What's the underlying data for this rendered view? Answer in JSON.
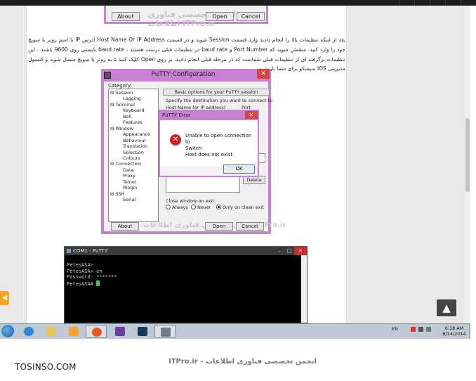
{
  "paragraph": "بعد از اینکه تنظیمات بالا را انجام دادید وارد قسمت Session شوید و در قسمت Host Name Or IP Address آدرس IP یا اسم روتر یا سویچ خود را وارد کنید. مطمئن شوید که Port Number و baud rate در تنظیمات قبلی درست هستند ، baud rate بایستی روی 9600 باشند ، این تنظیمات برگرفته ای از تنظیمات قبلی شماست که در مرحله قبلی انجام دادید. بر روی Open کلیک کنید تا به روتر یا سویچ متصل شوید و کنسول مدیریتی IOS سیسکو برای شما باز شود.",
  "top_crop": {
    "about_label": "About",
    "open_label": "Open",
    "cancel_label": "Cancel",
    "watermark": "انجمن تخصصی فناوری اطلاعات ITPro.ir"
  },
  "putty_config": {
    "title": "PuTTY Configuration",
    "category_label": "Category:",
    "tree": [
      {
        "label": "Session",
        "prefix": "⊟"
      },
      {
        "label": "Logging",
        "prefix": ""
      },
      {
        "label": "Terminal",
        "prefix": "⊟"
      },
      {
        "label": "Keyboard",
        "prefix": ""
      },
      {
        "label": "Bell",
        "prefix": ""
      },
      {
        "label": "Features",
        "prefix": ""
      },
      {
        "label": "Window",
        "prefix": "⊟"
      },
      {
        "label": "Appearance",
        "prefix": ""
      },
      {
        "label": "Behaviour",
        "prefix": ""
      },
      {
        "label": "Translation",
        "prefix": ""
      },
      {
        "label": "Selection",
        "prefix": ""
      },
      {
        "label": "Colours",
        "prefix": ""
      },
      {
        "label": "Connection",
        "prefix": "⊟"
      },
      {
        "label": "Data",
        "prefix": ""
      },
      {
        "label": "Proxy",
        "prefix": ""
      },
      {
        "label": "Telnet",
        "prefix": ""
      },
      {
        "label": "Rlogin",
        "prefix": ""
      },
      {
        "label": "SSH",
        "prefix": "⊞"
      },
      {
        "label": "Serial",
        "prefix": ""
      }
    ],
    "basic_options_label": "Basic options for your PuTTY session",
    "specify_label": "Specify the destination you want to connect to",
    "host_label": "Host Name (or IP address)",
    "port_label": "Port",
    "delete_label": "Delete",
    "close_window_label": "Close window on exit:",
    "radio_always": "Always",
    "radio_never": "Never",
    "radio_clean": "Only on clean exit",
    "about_label": "About",
    "open_label": "Open",
    "cancel_label": "Cancel",
    "watermark": "انجمن تخصصی فناوری اطلاعات ITPro.ir"
  },
  "error_dialog": {
    "title": "PuTTY Error",
    "line1": "Unable to open connection to",
    "line2": "Switch",
    "line3": "Host does not exist",
    "ok_label": "OK"
  },
  "terminal": {
    "title": "COM1 - PuTTY",
    "lines": [
      "PetesASA>",
      "PetesASA> en",
      "Password: *******",
      "PetesASA# "
    ]
  },
  "taskbar": {
    "lang": "EN",
    "time": "6:18 AM",
    "date": "8/14/2014"
  },
  "footer": {
    "logo": "TOSINSO.COM",
    "caption": "انجمن تخصصی فناوری اطلاعات - ITPro.ir"
  },
  "colors": {
    "accent": "#c880d2",
    "close": "#d64541",
    "cursor": "#2fd14d"
  }
}
